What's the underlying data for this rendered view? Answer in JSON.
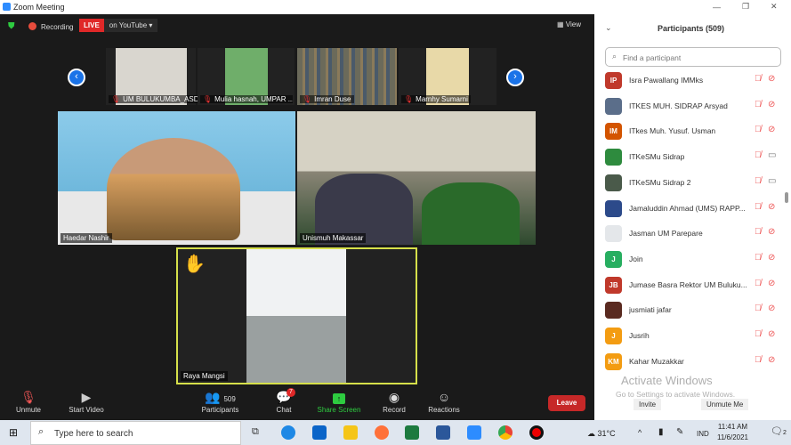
{
  "window": {
    "title": "Zoom Meeting",
    "min": "—",
    "max": "❐",
    "close": "✕"
  },
  "topbar": {
    "recording": "Recording",
    "live": "LIVE",
    "live_dest": "on YouTube",
    "view": "View"
  },
  "thumbnails": [
    {
      "name": "UM BULUKUMBA_ASD...",
      "color": "#d9d6cf"
    },
    {
      "name": "Mulia hasnah, UMPAR ...",
      "color": "#6fae6a"
    },
    {
      "name": "Imran Duse",
      "color": "#6b6a5a"
    },
    {
      "name": "Marnhy Sumarni",
      "color": "#e8d9a8"
    }
  ],
  "videos": [
    {
      "name": "Haedar Nashir",
      "color": "#7fc4e6"
    },
    {
      "name": "Unismuh Makassar",
      "color": "#8a8576"
    },
    {
      "name": "Raya Mangsi",
      "color": "#e9ecee",
      "hand": "✋",
      "active_border": "#d6e04a"
    }
  ],
  "toolbar": {
    "unmute": "Unmute",
    "start_video": "Start Video",
    "participants": "Participants",
    "participants_count": "509",
    "chat": "Chat",
    "chat_badge": "7",
    "share": "Share Screen",
    "record": "Record",
    "reactions": "Reactions",
    "leave": "Leave"
  },
  "panel": {
    "title": "Participants (509)",
    "search_placeholder": "Find a participant",
    "invite": "Invite",
    "unmute_me": "Unmute Me",
    "participants": [
      {
        "initials": "IP",
        "name": "Isra Pawallang IMMks",
        "color": "#c0392b",
        "video": false
      },
      {
        "initials": "",
        "name": "ITKES MUH. SIDRAP Arsyad",
        "color": "#5b6e8a",
        "video": false
      },
      {
        "initials": "IM",
        "name": "ITkes Muh. Yusuf. Usman",
        "color": "#d35400",
        "video": false
      },
      {
        "initials": "",
        "name": "ITKeSMu Sidrap",
        "color": "#2e8b3e",
        "video": true
      },
      {
        "initials": "",
        "name": "ITKeSMu Sidrap 2",
        "color": "#4a5a4a",
        "video": true
      },
      {
        "initials": "",
        "name": "Jamaluddin Ahmad (UMS) RAPP...",
        "color": "#2c4a8a",
        "video": false
      },
      {
        "initials": "",
        "name": "Jasman UM Parepare",
        "color": "#e4e7ea",
        "video": false
      },
      {
        "initials": "J",
        "name": "Join",
        "color": "#27ae60",
        "video": false
      },
      {
        "initials": "JB",
        "name": "Jumase Basra Rektor UM Buluku...",
        "color": "#c0392b",
        "video": false
      },
      {
        "initials": "",
        "name": "jusmiati jafar",
        "color": "#5a2a20",
        "video": false
      },
      {
        "initials": "J",
        "name": "Jusrih",
        "color": "#f39c12",
        "video": false
      },
      {
        "initials": "KM",
        "name": "Kahar Muzakkar",
        "color": "#f39c12",
        "video": false
      }
    ]
  },
  "watermark": {
    "line1": "Activate Windows",
    "line2": "Go to Settings to activate Windows."
  },
  "taskbar": {
    "search_placeholder": "Type here to search",
    "weather": "31°C",
    "lang": "IND",
    "time": "11:41 AM",
    "date": "11/6/2021",
    "notif": "2"
  }
}
